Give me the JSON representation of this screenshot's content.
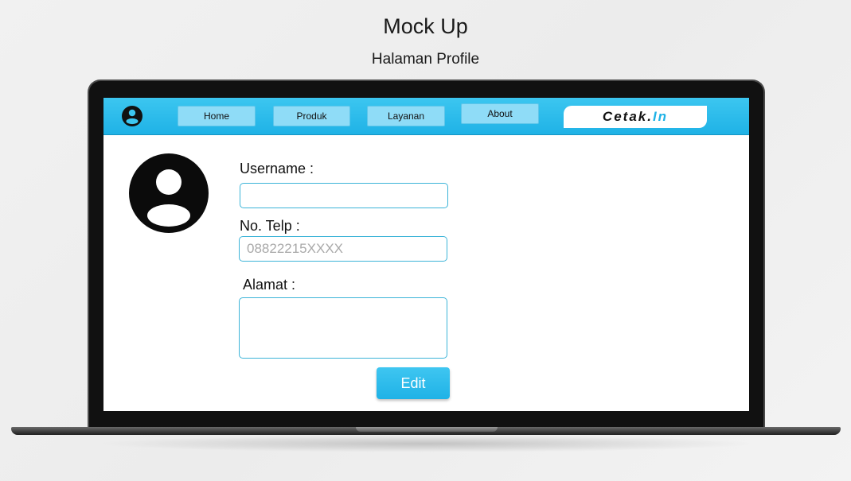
{
  "header": {
    "title": "Mock Up",
    "subtitle": "Halaman Profile"
  },
  "navbar": {
    "items": [
      {
        "label": "Home"
      },
      {
        "label": "Produk"
      },
      {
        "label": "Layanan"
      },
      {
        "label": "About"
      }
    ],
    "brand": {
      "prefix": "Cetak.",
      "suffix": "In"
    },
    "accent_color": "#1fb2e6"
  },
  "profile": {
    "username_label": "Username :",
    "username_value": "",
    "phone_label": "No. Telp :",
    "phone_placeholder": "08822215XXXX",
    "address_label": "Alamat :",
    "address_value": "",
    "edit_label": "Edit"
  },
  "icons": {
    "nav_user": "user-circle-icon",
    "avatar": "user-avatar-icon"
  }
}
